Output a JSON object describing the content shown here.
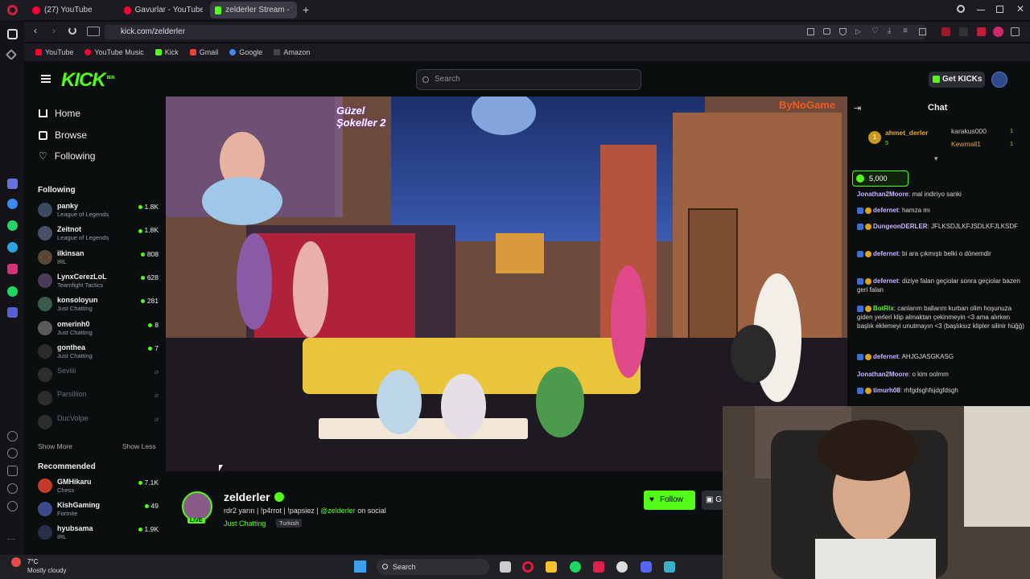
{
  "browser": {
    "tabs": [
      {
        "label": "(27) YouTube",
        "active": false
      },
      {
        "label": "Gavurlar - YouTube M",
        "active": false
      },
      {
        "label": "zelderler Stream - Wat",
        "active": true
      }
    ],
    "new_tab_glyph": "+",
    "url": "kick.com/zelderler",
    "bookmarks": [
      "YouTube",
      "YouTube Music",
      "Kick",
      "Gmail",
      "Google",
      "Amazon"
    ]
  },
  "header": {
    "logo": "KICK",
    "logo_tag": "BETA",
    "search_placeholder": "Search",
    "get_kicks_label": "Get KICKs"
  },
  "sidebar": {
    "nav": [
      {
        "label": "Home",
        "icon": "home-icon"
      },
      {
        "label": "Browse",
        "icon": "browse-icon"
      },
      {
        "label": "Following",
        "icon": "heart-icon"
      }
    ],
    "following_title": "Following",
    "following": [
      {
        "name": "panky",
        "category": "League of Legends",
        "viewers": "1.8K",
        "live": true
      },
      {
        "name": "Zeitnot",
        "category": "League of Legends",
        "viewers": "1.8K",
        "live": true
      },
      {
        "name": "ilkinsan",
        "category": "IRL",
        "viewers": "808",
        "live": true
      },
      {
        "name": "LynxCerezLoL",
        "category": "Teamfight Tactics",
        "viewers": "628",
        "live": true
      },
      {
        "name": "konsoloyun",
        "category": "Just Chatting",
        "viewers": "281",
        "live": true
      },
      {
        "name": "omerinh0",
        "category": "Just Chatting",
        "viewers": "8",
        "live": true
      },
      {
        "name": "gonthea",
        "category": "Just Chatting",
        "viewers": "7",
        "live": true
      },
      {
        "name": "Seviiii",
        "category": "",
        "viewers": "",
        "live": false
      },
      {
        "name": "Parsillion",
        "category": "",
        "viewers": "",
        "live": false
      },
      {
        "name": "DucVolpe",
        "category": "",
        "viewers": "",
        "live": false
      }
    ],
    "show_more": "Show More",
    "show_less": "Show Less",
    "recommended_title": "Recommended",
    "recommended": [
      {
        "name": "GMHikaru",
        "category": "Chess",
        "viewers": "7.1K"
      },
      {
        "name": "KishGaming",
        "category": "Fortnite",
        "viewers": "49"
      },
      {
        "name": "hyubsama",
        "category": "IRL",
        "viewers": "1.9K"
      }
    ]
  },
  "video": {
    "overlay_logo_text": "Güzel Şokeller 2",
    "watermark": "ByNoGame"
  },
  "channel": {
    "name": "zelderler",
    "live_label": "LIVE",
    "title_prefix": "rdr2 yarın | !p4rrot | !papsiez | ",
    "title_handle": "@zelderler",
    "title_suffix": " on social",
    "category": "Just Chatting",
    "tag": "Turkish",
    "follow_label": "Follow",
    "gift_label": "G"
  },
  "chat": {
    "title": "Chat",
    "pinned_users": [
      {
        "name": "ahmet_derler",
        "count": "5"
      },
      {
        "name": "karakus000",
        "count": "1"
      },
      {
        "name": "Kewmall1",
        "count": "1"
      }
    ],
    "kicks_amount": "5,000",
    "messages": [
      {
        "user": "Jonathan2Moore",
        "text": "mal indiriyo sanki",
        "color": "#c9b6ff"
      },
      {
        "user": "defernet",
        "text": "hamza mı",
        "color": "#c9b6ff"
      },
      {
        "user": "DungeonDERLER",
        "text": "JFLKSDJLKFJSDLKFJLKSDF",
        "color": "#c9b6ff"
      },
      {
        "user": "defernet",
        "text": "bi ara çıkmıştı belki o dönemdir",
        "color": "#c9b6ff"
      },
      {
        "user": "defernet",
        "text": "diziye falan geçiolar sonra geçiolar bazen geri falan",
        "color": "#c9b6ff"
      },
      {
        "user": "BotRix",
        "text": "canlarım ballarım kurban olim hoşunuza giden yerleri klip almaktan çekinmeyin <3 ama alırken başlık eklemeyi unutmayın <3 (başlıksız klipler silinir hüğğ)",
        "color": "#53fc18"
      },
      {
        "user": "defernet",
        "text": "AHJGJASGKASG",
        "color": "#c9b6ff"
      },
      {
        "user": "Jonathan2Moore",
        "text": "o kim oolmm",
        "color": "#c9b6ff"
      },
      {
        "user": "timurh08",
        "text": "rhfgdsghfsjdgfdsgh",
        "color": "#c9b6ff"
      }
    ]
  },
  "taskbar": {
    "weather_temp": "7°C",
    "weather_desc": "Mostly cloudy",
    "search_label": "Search"
  },
  "colors": {
    "kick_green": "#53fc18",
    "background": "#0b0e0f",
    "chrome": "#1c1b22"
  }
}
